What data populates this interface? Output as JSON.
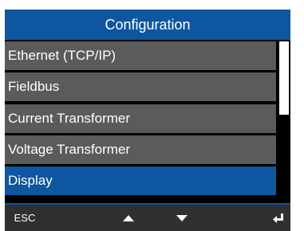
{
  "header": {
    "title": "Configuration"
  },
  "menu": {
    "items": [
      {
        "label": "Ethernet (TCP/IP)"
      },
      {
        "label": "Fieldbus"
      },
      {
        "label": "Current Transformer"
      },
      {
        "label": "Voltage Transformer"
      },
      {
        "label": "Display",
        "selected": true
      }
    ]
  },
  "softkeys": {
    "esc_label": "ESC",
    "up_icon": "triangle-up-icon",
    "down_icon": "triangle-down-icon",
    "enter_icon": "enter-return-icon"
  },
  "colors": {
    "accent": "#0e56a0",
    "item_background": "#5b5b5b",
    "softkey_bar": "#303030",
    "text": "#ffffff"
  }
}
